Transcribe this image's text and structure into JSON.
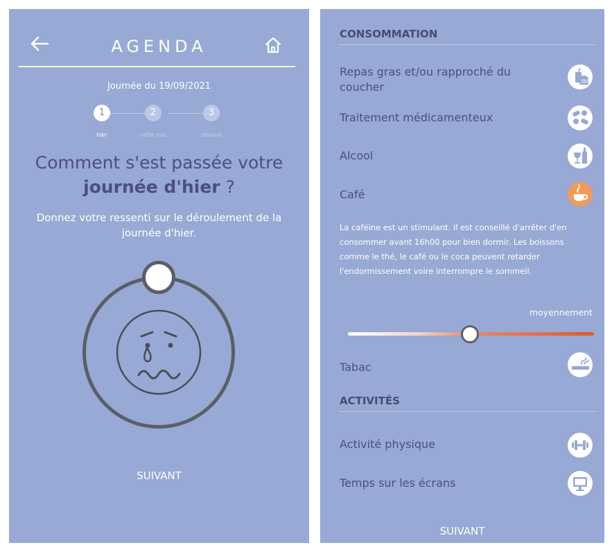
{
  "left": {
    "title": "AGENDA",
    "date": "Journée du 19/09/2021",
    "steps": [
      {
        "number": "1",
        "label": "hier",
        "active": true
      },
      {
        "number": "2",
        "label": "cette nuit",
        "active": false
      },
      {
        "number": "3",
        "label": "résumé",
        "active": false
      }
    ],
    "question_line1": "Comment s'est passée votre",
    "question_bold": "journée d'hier",
    "question_end": " ?",
    "help_text": "Donnez votre ressenti sur le déroulement de la journée d'hier.",
    "next_label": "SUIVANT",
    "icons": {
      "back": "arrow-left-icon",
      "home": "home-icon",
      "face": "crying-face-icon"
    }
  },
  "right": {
    "section_consumption": "CONSOMMATION",
    "items": [
      {
        "label": "Repas gras et/ou rapproché du coucher",
        "icon": "fast-food-icon",
        "selected": false
      },
      {
        "label": "Traitement médicamenteux",
        "icon": "pills-icon",
        "selected": false
      },
      {
        "label": "Alcool",
        "icon": "alcohol-icon",
        "selected": false
      },
      {
        "label": "Café",
        "icon": "coffee-icon",
        "selected": true
      },
      {
        "label": "Tabac",
        "icon": "cigarette-icon",
        "selected": false
      }
    ],
    "cafe_info": "La caféine est un stimulant. Il est conseillé d'arrêter d'en consommer avant 16h00 pour bien dormir. Les boissons comme le thé, le café ou le coca peuvent retarder l'endormissement voire interrompre le sommeil.",
    "cafe_level_label": "moyennement",
    "cafe_level_fraction": 0.5,
    "section_activities": "ACTIVITÉS",
    "activities": [
      {
        "label": "Activité physique",
        "icon": "dumbbell-icon"
      },
      {
        "label": "Temps sur les écrans",
        "icon": "monitor-icon"
      }
    ],
    "next_label": "SUIVANT"
  },
  "colors": {
    "background": "#97a9d4",
    "heading_text": "#4d4e82",
    "accent_orange": "#f29a5b",
    "slider_end": "#dd5a2a"
  }
}
